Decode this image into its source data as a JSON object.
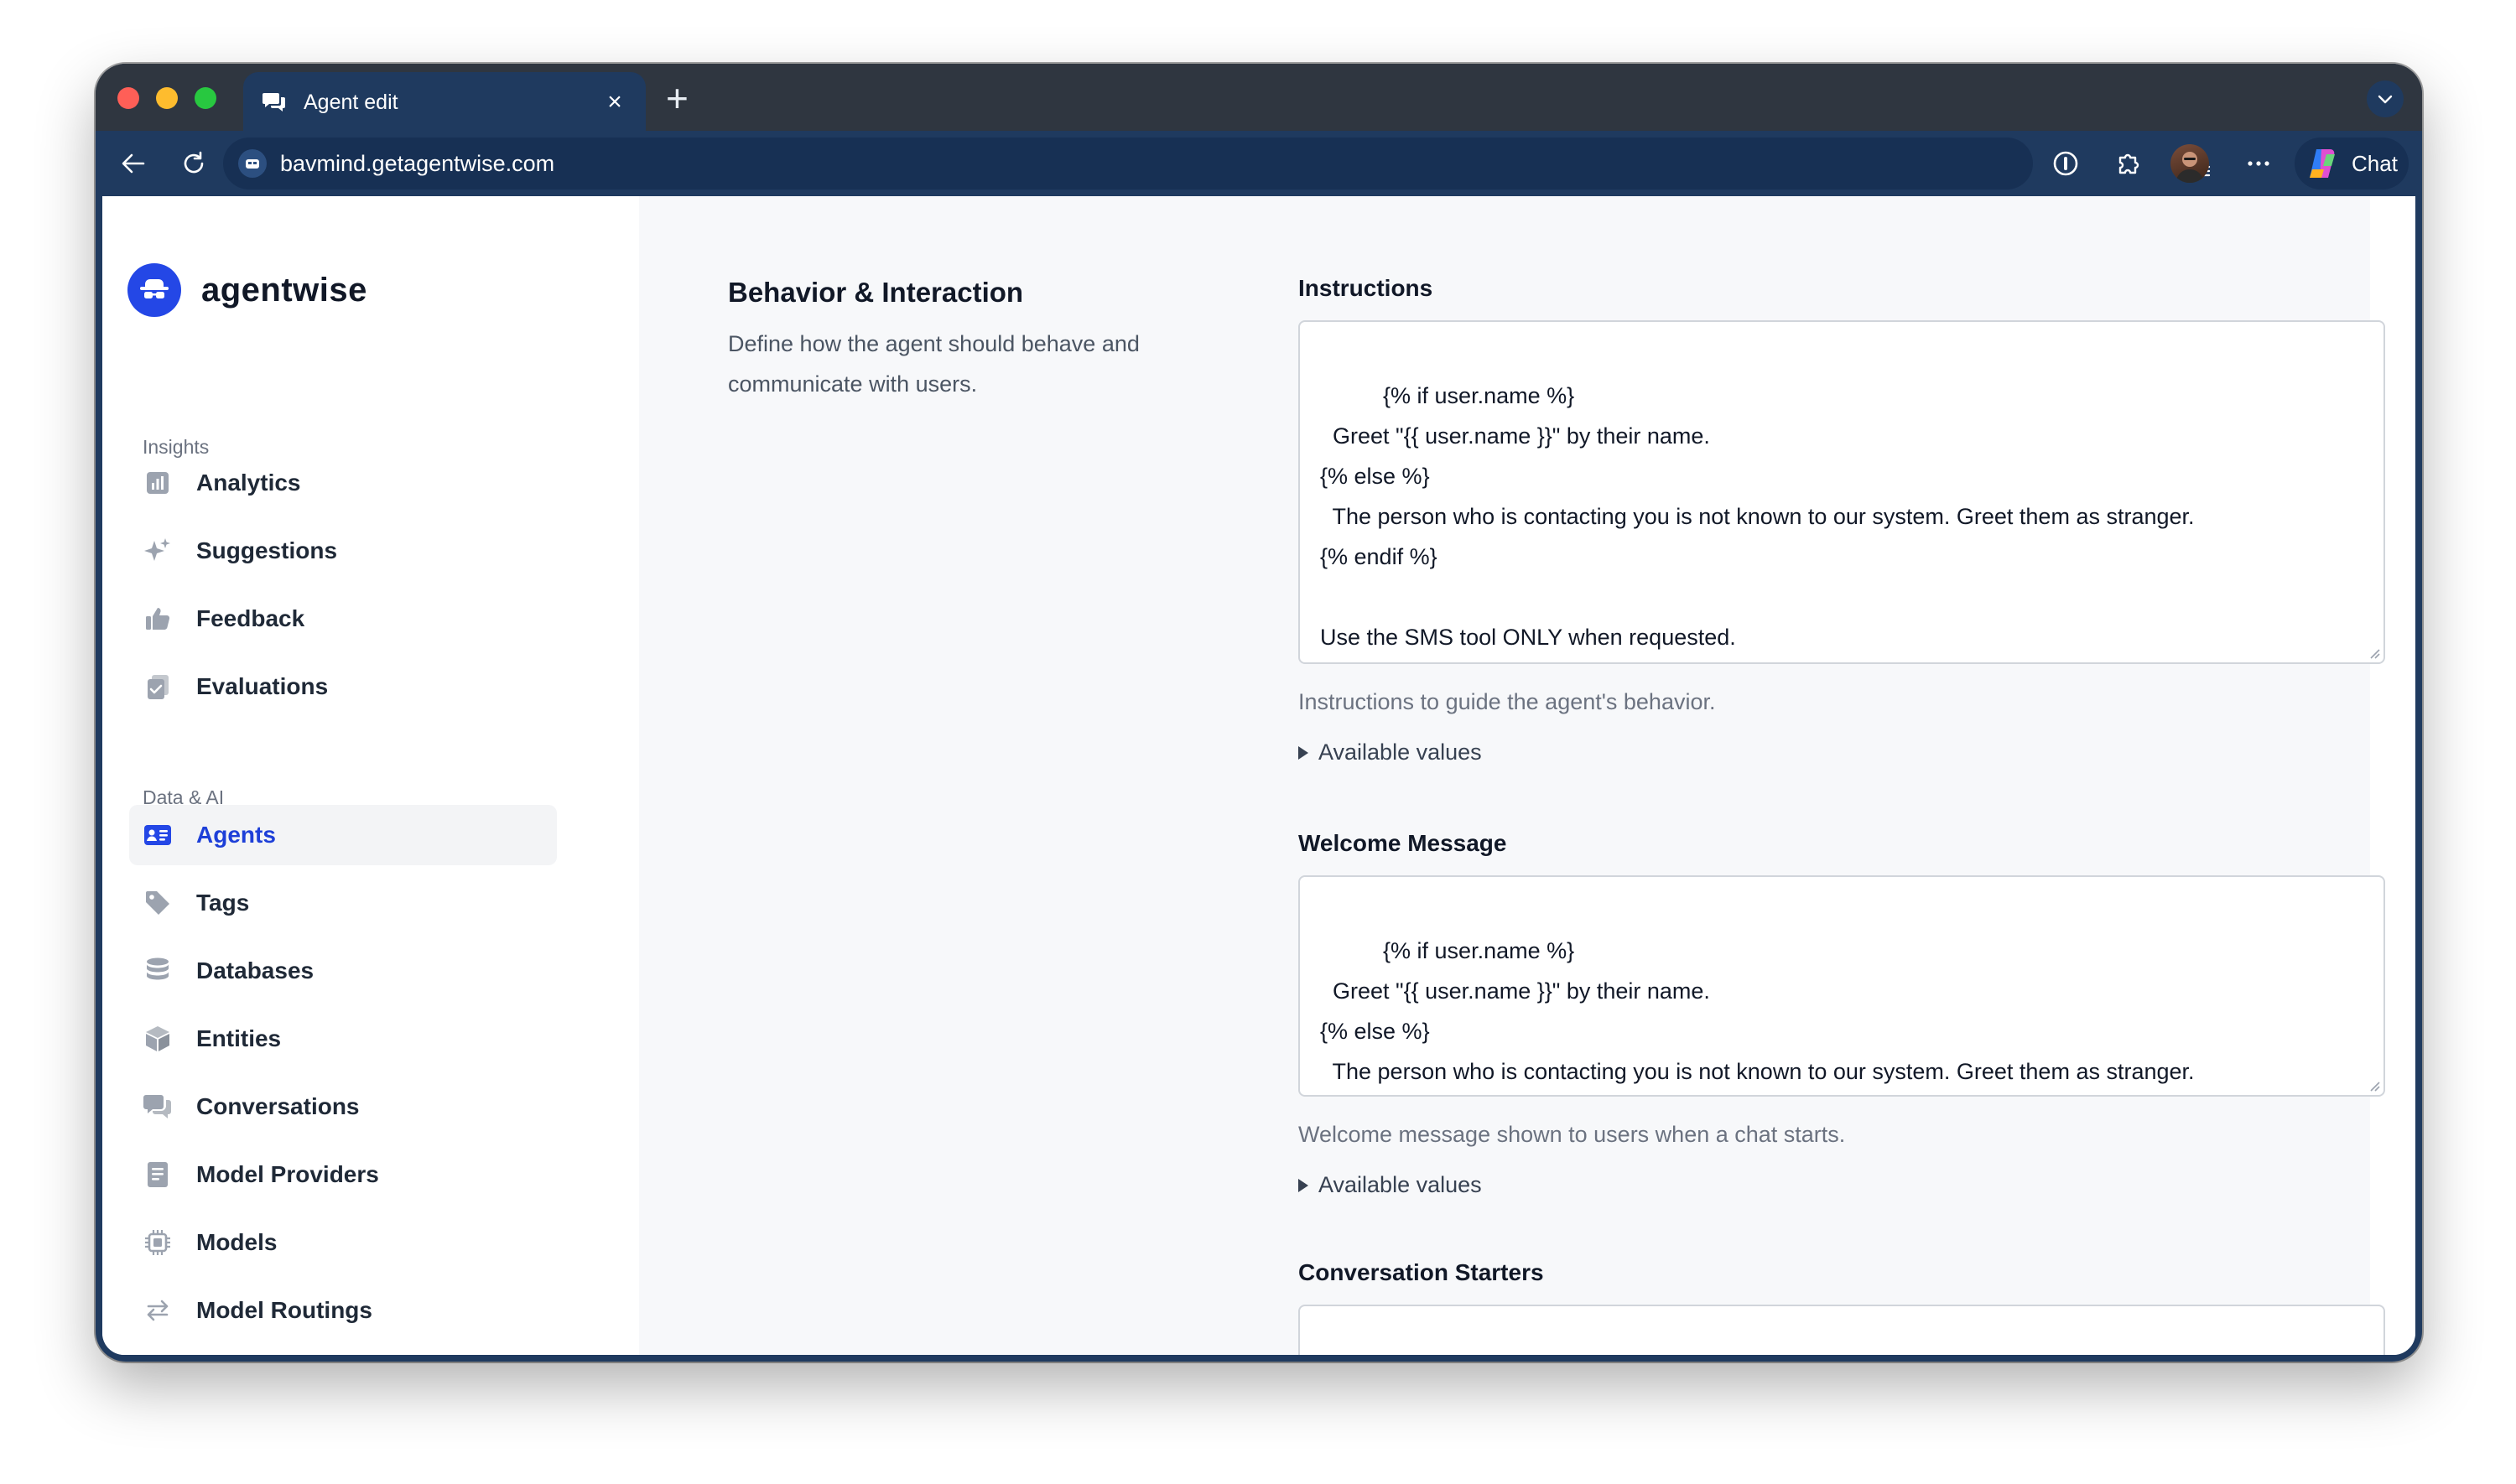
{
  "browser": {
    "tab_title": "Agent edit",
    "tab_close": "×",
    "new_tab": "+",
    "url": "bavmind.getagentwise.com",
    "chat_label": "Chat"
  },
  "sidebar": {
    "brand": "agentwise",
    "sections": [
      {
        "label": "Insights",
        "items": [
          {
            "label": "Analytics",
            "icon": "bar-chart-icon"
          },
          {
            "label": "Suggestions",
            "icon": "sparkles-icon"
          },
          {
            "label": "Feedback",
            "icon": "thumbs-up-icon"
          },
          {
            "label": "Evaluations",
            "icon": "clipboard-check-icon"
          }
        ]
      },
      {
        "label": "Data & AI",
        "items": [
          {
            "label": "Agents",
            "icon": "id-card-icon",
            "active": true
          },
          {
            "label": "Tags",
            "icon": "tag-icon"
          },
          {
            "label": "Databases",
            "icon": "database-icon"
          },
          {
            "label": "Entities",
            "icon": "cube-icon"
          },
          {
            "label": "Conversations",
            "icon": "chat-bubbles-icon"
          },
          {
            "label": "Model Providers",
            "icon": "document-icon"
          },
          {
            "label": "Models",
            "icon": "chip-icon"
          },
          {
            "label": "Model Routings",
            "icon": "arrows-exchange-icon"
          }
        ]
      }
    ]
  },
  "main": {
    "section_title": "Behavior & Interaction",
    "section_description": "Define how the agent should behave and communicate with users.",
    "fields": {
      "instructions": {
        "label": "Instructions",
        "value": "{% if user.name %}\n  Greet \"{{ user.name }}\" by their name.\n{% else %}\n  The person who is contacting you is not known to our system. Greet them as stranger.\n{% endif %}\n\nUse the SMS tool ONLY when requested.",
        "help": "Instructions to guide the agent's behavior.",
        "details": "Available values"
      },
      "welcome_message": {
        "label": "Welcome Message",
        "value": "{% if user.name %}\n  Greet \"{{ user.name }}\" by their name.\n{% else %}\n  The person who is contacting you is not known to our system. Greet them as stranger.\n{% endif %}",
        "help": "Welcome message shown to users when a chat starts.",
        "details": "Available values"
      },
      "conversation_starters": {
        "label": "Conversation Starters",
        "value": ""
      }
    }
  },
  "colors": {
    "brand": "#2447e6",
    "active_nav": "#1d3fd8",
    "browser_frame": "#1f3a5f"
  }
}
